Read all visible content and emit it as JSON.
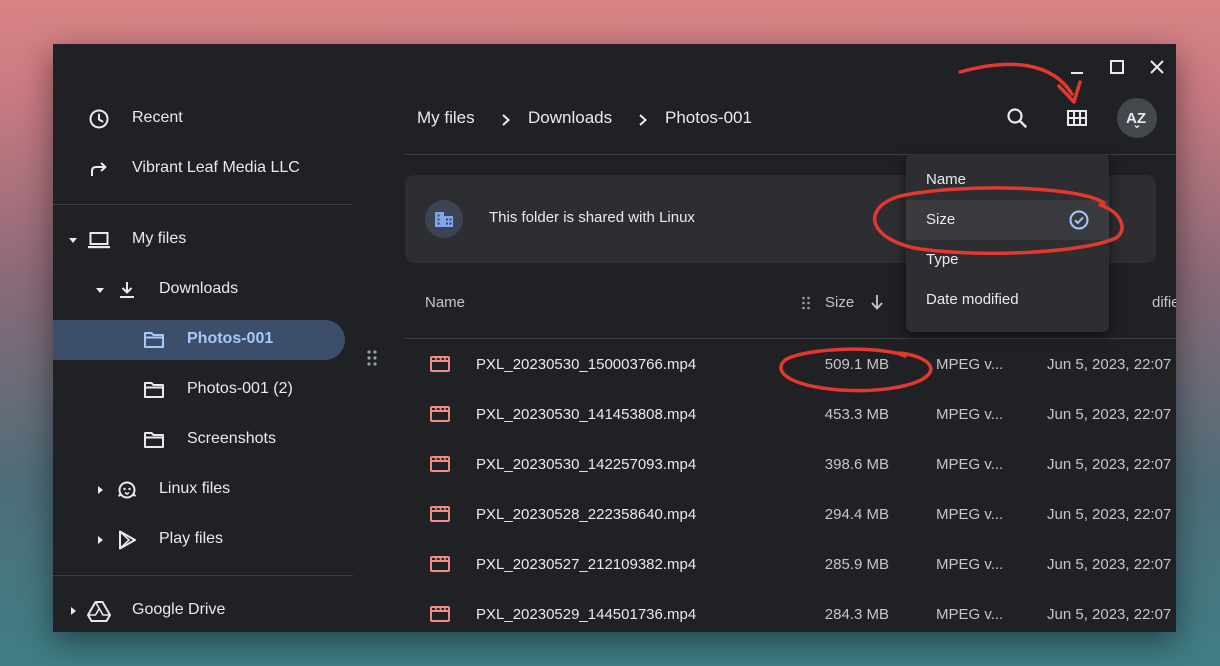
{
  "sidebar": {
    "items": [
      {
        "label": "Recent",
        "icon": "clock-icon"
      },
      {
        "label": "Vibrant Leaf Media LLC",
        "icon": "share-arrow-icon"
      },
      {
        "label": "My files",
        "icon": "laptop-icon"
      },
      {
        "label": "Downloads",
        "icon": "download-icon"
      },
      {
        "label": "Photos-001",
        "icon": "folder-icon",
        "selected": true
      },
      {
        "label": "Photos-001 (2)",
        "icon": "folder-icon"
      },
      {
        "label": "Screenshots",
        "icon": "folder-icon"
      },
      {
        "label": "Linux files",
        "icon": "penguin-icon"
      },
      {
        "label": "Play files",
        "icon": "play-store-icon"
      },
      {
        "label": "Google Drive",
        "icon": "google-drive-icon"
      }
    ]
  },
  "breadcrumb": [
    "My files",
    "Downloads",
    "Photos-001"
  ],
  "banner": {
    "text": "This folder is shared with Linux",
    "icon": "linux-building-icon"
  },
  "columns": {
    "name": "Name",
    "size": "Size",
    "date_partial": "dified"
  },
  "files": [
    {
      "name": "PXL_20230530_150003766.mp4",
      "size": "509.1 MB",
      "type": "MPEG v...",
      "date": "Jun 5, 2023, 22:07"
    },
    {
      "name": "PXL_20230530_141453808.mp4",
      "size": "453.3 MB",
      "type": "MPEG v...",
      "date": "Jun 5, 2023, 22:07"
    },
    {
      "name": "PXL_20230530_142257093.mp4",
      "size": "398.6 MB",
      "type": "MPEG v...",
      "date": "Jun 5, 2023, 22:07"
    },
    {
      "name": "PXL_20230528_222358640.mp4",
      "size": "294.4 MB",
      "type": "MPEG v...",
      "date": "Jun 5, 2023, 22:07"
    },
    {
      "name": "PXL_20230527_212109382.mp4",
      "size": "285.9 MB",
      "type": "MPEG v...",
      "date": "Jun 5, 2023, 22:07"
    },
    {
      "name": "PXL_20230529_144501736.mp4",
      "size": "284.3 MB",
      "type": "MPEG v...",
      "date": "Jun 5, 2023, 22:07"
    }
  ],
  "sort_menu": {
    "items": [
      {
        "label": "Name"
      },
      {
        "label": "Size",
        "checked": true
      },
      {
        "label": "Type"
      },
      {
        "label": "Date modified"
      }
    ]
  },
  "toolbar": {
    "sort_label": "AZ"
  },
  "colors": {
    "window_bg": "#202124",
    "selected_bg": "#3d4e6b",
    "selected_text": "#a8c7fa",
    "video_icon": "#f28b82",
    "annotation_red": "#e2382f"
  }
}
